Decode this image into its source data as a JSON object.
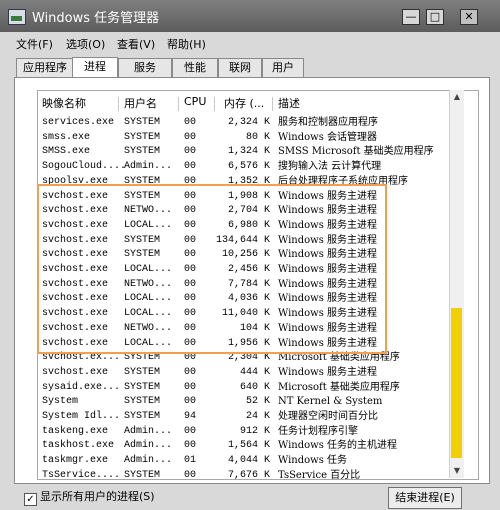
{
  "window": {
    "title": "Windows 任务管理器",
    "controls": {
      "minimize": "—",
      "maximize": "□",
      "close": "✕"
    }
  },
  "menu": [
    "文件(F)",
    "选项(O)",
    "查看(V)",
    "帮助(H)"
  ],
  "tabs": [
    "应用程序",
    "进程",
    "服务",
    "性能",
    "联网",
    "用户"
  ],
  "active_tab": "进程",
  "table": {
    "columns": [
      "映像名称",
      "用户名",
      "CPU",
      "内存 (...",
      "描述"
    ],
    "rows": [
      [
        "services.exe",
        "SYSTEM",
        "00",
        "2,324 K",
        "服务和控制器应用程序"
      ],
      [
        "smss.exe",
        "SYSTEM",
        "00",
        "80 K",
        "Windows 会话管理器"
      ],
      [
        "SMSS.exe",
        "SYSTEM",
        "00",
        "1,324 K",
        "SMSS Microsoft 基础类应用程序"
      ],
      [
        "SogouCloud....",
        "Admin...",
        "00",
        "6,576 K",
        "搜狗输入法 云计算代理"
      ],
      [
        "spoolsv.exe",
        "SYSTEM",
        "00",
        "1,352 K",
        "后台处理程序子系统应用程序"
      ],
      [
        "svchost.exe",
        "SYSTEM",
        "00",
        "1,908 K",
        "Windows 服务主进程"
      ],
      [
        "svchost.exe",
        "NETWO...",
        "00",
        "2,704 K",
        "Windows 服务主进程"
      ],
      [
        "svchost.exe",
        "LOCAL...",
        "00",
        "6,980 K",
        "Windows 服务主进程"
      ],
      [
        "svchost.exe",
        "SYSTEM",
        "00",
        "134,644 K",
        "Windows 服务主进程"
      ],
      [
        "svchost.exe",
        "SYSTEM",
        "00",
        "10,256 K",
        "Windows 服务主进程"
      ],
      [
        "svchost.exe",
        "LOCAL...",
        "00",
        "2,456 K",
        "Windows 服务主进程"
      ],
      [
        "svchost.exe",
        "NETWO...",
        "00",
        "7,784 K",
        "Windows 服务主进程"
      ],
      [
        "svchost.exe",
        "LOCAL...",
        "00",
        "4,036 K",
        "Windows 服务主进程"
      ],
      [
        "svchost.exe",
        "LOCAL...",
        "00",
        "11,040 K",
        "Windows 服务主进程"
      ],
      [
        "svchost.exe",
        "NETWO...",
        "00",
        "104 K",
        "Windows 服务主进程"
      ],
      [
        "svchost.exe",
        "LOCAL...",
        "00",
        "1,956 K",
        "Windows 服务主进程"
      ],
      [
        "svchost.ex...",
        "SYSTEM",
        "00",
        "2,304 K",
        "Microsoft 基础类应用程序"
      ],
      [
        "svchost.exe",
        "SYSTEM",
        "00",
        "444 K",
        "Windows 服务主进程"
      ],
      [
        "sysaid.exe...",
        "SYSTEM",
        "00",
        "640 K",
        "Microsoft 基础类应用程序"
      ],
      [
        "System",
        "SYSTEM",
        "00",
        "52 K",
        "NT Kernel & System"
      ],
      [
        "System Idl...",
        "SYSTEM",
        "94",
        "24 K",
        "处理器空闲时间百分比"
      ],
      [
        "taskeng.exe",
        "Admin...",
        "00",
        "912 K",
        "任务计划程序引擎"
      ],
      [
        "taskhost.exe",
        "Admin...",
        "00",
        "1,564 K",
        "Windows 任务的主机进程"
      ],
      [
        "taskmgr.exe",
        "Admin...",
        "01",
        "4,044 K",
        "Windows 任务"
      ],
      [
        "TsService....",
        "SYSTEM",
        "00",
        "7,676 K",
        "TsService 百分比"
      ]
    ]
  },
  "show_all_users": {
    "label": "显示所有用户的进程(S)",
    "checked": true
  },
  "end_process_button": "结束进程(E)",
  "highlight_color": "#f0a050",
  "scrollbar_thumb_color": "#f2d000"
}
